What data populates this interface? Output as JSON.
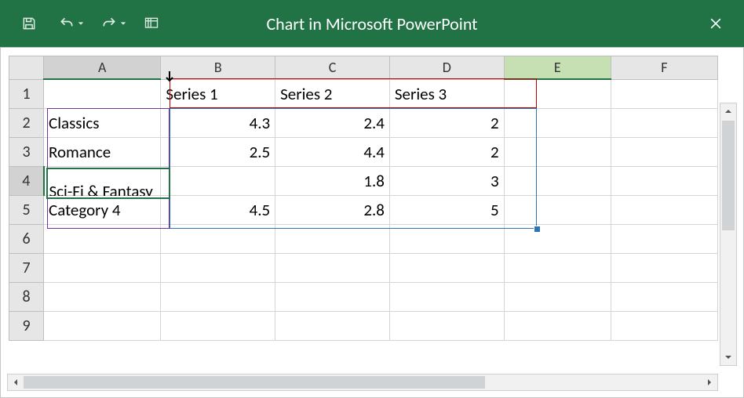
{
  "title": "Chart in Microsoft PowerPoint",
  "columns": [
    "A",
    "B",
    "C",
    "D",
    "E",
    "F"
  ],
  "active_cell": "A4",
  "selected_column": "E",
  "sheet": {
    "headers": {
      "b1": "Series 1",
      "c1": "Series 2",
      "d1": "Series 3"
    },
    "rows": [
      "1",
      "2",
      "3",
      "4",
      "5",
      "6",
      "7",
      "8",
      "9"
    ],
    "data": {
      "a2": "Classics",
      "b2": "4.3",
      "c2": "2.4",
      "d2": "2",
      "a3": "Romance",
      "b3": "2.5",
      "c3": "4.4",
      "d3": "2",
      "a4": "Sci-Fi & Fantasy",
      "c4": "1.8",
      "d4": "3",
      "a5": "Category 4",
      "b5": "4.5",
      "c5": "2.8",
      "d5": "5"
    }
  },
  "chart_data": {
    "type": "bar",
    "categories": [
      "Classics",
      "Romance",
      "Sci-Fi & Fantasy",
      "Category 4"
    ],
    "series": [
      {
        "name": "Series 1",
        "values": [
          4.3,
          2.5,
          null,
          4.5
        ]
      },
      {
        "name": "Series 2",
        "values": [
          2.4,
          4.4,
          1.8,
          2.8
        ]
      },
      {
        "name": "Series 3",
        "values": [
          2,
          2,
          3,
          5
        ]
      }
    ],
    "title": "",
    "xlabel": "",
    "ylabel": ""
  }
}
